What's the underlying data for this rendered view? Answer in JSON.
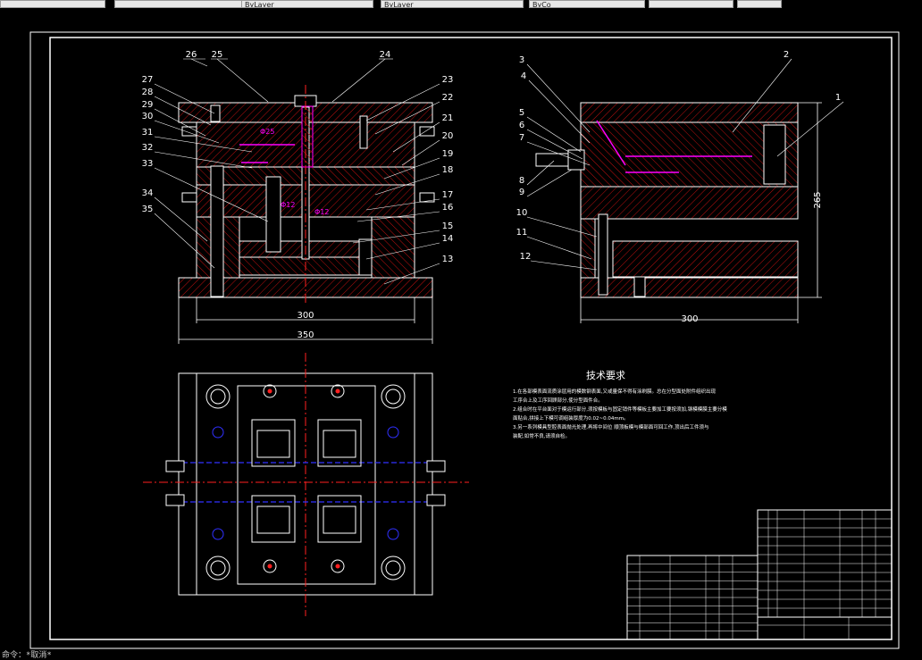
{
  "toolbar": {
    "fields": [
      "",
      "",
      "ByLayer",
      "ByLayer",
      "ByCo",
      "",
      ""
    ]
  },
  "colors": {
    "background": "#000000",
    "outline": "#ffffff",
    "hatch": "#c01010",
    "centerline": "#ff2020",
    "dimension": "#ffffff",
    "magenta": "#ff00ff",
    "blue": "#3030ff",
    "cyan": "#00c0ff",
    "yellow": "#ffff00"
  },
  "front_view": {
    "part_labels": [
      "26",
      "25",
      "24",
      "27",
      "28",
      "29",
      "30",
      "31",
      "32",
      "33",
      "34",
      "35",
      "23",
      "22",
      "21",
      "20",
      "19",
      "18",
      "17",
      "16",
      "15",
      "14",
      "13"
    ],
    "dim_inner": "300",
    "dim_outer": "350",
    "dim_notes": [
      "Φ25",
      "Φ12",
      "Φ12"
    ]
  },
  "side_view": {
    "part_labels": [
      "3",
      "2",
      "1",
      "4",
      "5",
      "6",
      "7",
      "8",
      "9",
      "10",
      "11",
      "12"
    ],
    "dim_width": "300",
    "dim_height": "265"
  },
  "tech_requirements": {
    "title": "技术要求",
    "lines": [
      "1.在各部模表面流质涂层用的模数钢表面,又或量保不得有涂刷膜。总在分型面处附件组织出现",
      "工序合上及工序回顾部分,使分型面件合。",
      "2.组合时在平台面对于模运行部分,须按模板与固定销件等模板主要加工要按须加,钢模模膜主要分模",
      "面贴合,拼接上下模可调组装厚度为0.02~0.04mm。",
      "3.另一系列模具型腔表面抛光处理,再将中间位 顺顶板模与模部面可回工作,顶出后工件须与",
      "装配,如常不良,请须自检。"
    ]
  },
  "command_line": "命令：*取消*"
}
